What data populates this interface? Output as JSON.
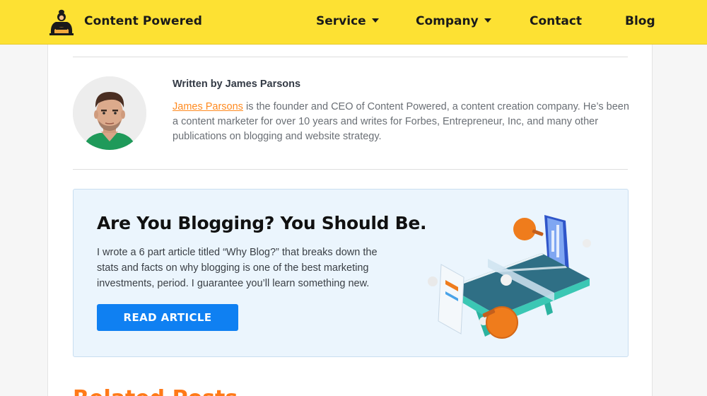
{
  "header": {
    "brand": "Content Powered",
    "nav": {
      "service": "Service",
      "company": "Company",
      "contact": "Contact",
      "blog": "Blog"
    }
  },
  "author": {
    "written_by": "Written by James Parsons",
    "bio_link": "James Parsons",
    "bio_text": " is the founder and CEO of Content Powered, a content creation company. He’s been a content marketer for over 10 years and writes for Forbes, Entrepreneur, Inc, and many other publications on blogging and website strategy."
  },
  "cta": {
    "title": "Are You Blogging? You Should Be.",
    "body": "I wrote a 6 part article titled “Why Blog?” that breaks down the stats and facts on why blogging is one of the best marketing investments, period. I guarantee you’ll learn something new.",
    "button": "READ ARTICLE"
  },
  "related_heading": "Related Posts",
  "colors": {
    "header_bg": "#fde133",
    "link": "#ff8a1f",
    "button": "#0f80f2",
    "cta_bg": "#ebf5fd",
    "related": "#ff7a18"
  }
}
